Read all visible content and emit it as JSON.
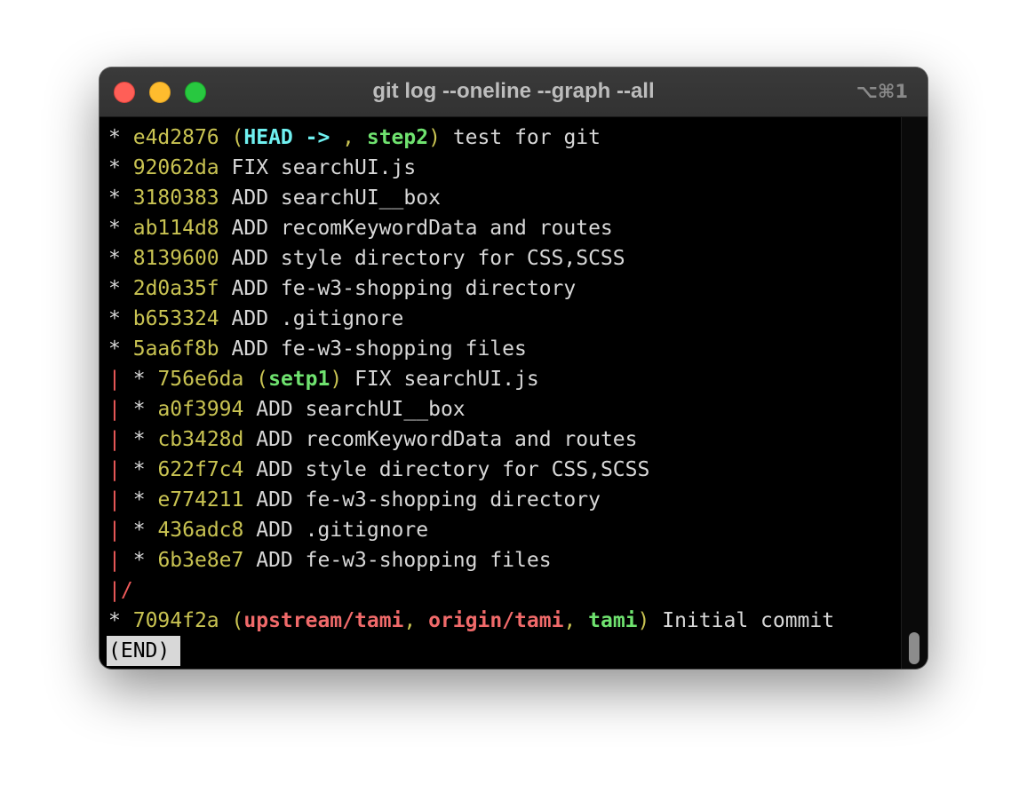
{
  "window": {
    "title": "git log --oneline --graph --all",
    "shortcut": "⌥⌘1"
  },
  "icons": {
    "close": "close-button",
    "minimize": "minimize-button",
    "zoom": "zoom-button"
  },
  "colors": {
    "background": "#000000",
    "text": "#d8d8d8",
    "hash": "#c9c352",
    "graph_branch": "#ee5a5a",
    "head_ref": "#6ff0f0",
    "local_branch": "#6fe26f",
    "remote_branch": "#f06a6a"
  },
  "log": [
    {
      "graph": "* ",
      "hash": "e4d2876",
      "refs": [
        {
          "text": "HEAD -> ",
          "color": "cyan"
        },
        {
          "text": "step2",
          "color": "green"
        }
      ],
      "message": "test for git"
    },
    {
      "graph": "* ",
      "hash": "92062da",
      "refs": [],
      "message": "FIX searchUI.js"
    },
    {
      "graph": "* ",
      "hash": "3180383",
      "refs": [],
      "message": "ADD searchUI__box"
    },
    {
      "graph": "* ",
      "hash": "ab114d8",
      "refs": [],
      "message": "ADD recomKeywordData and routes"
    },
    {
      "graph": "* ",
      "hash": "8139600",
      "refs": [],
      "message": "ADD style directory for CSS,SCSS"
    },
    {
      "graph": "* ",
      "hash": "2d0a35f",
      "refs": [],
      "message": "ADD fe-w3-shopping directory"
    },
    {
      "graph": "* ",
      "hash": "b653324",
      "refs": [],
      "message": "ADD .gitignore"
    },
    {
      "graph": "* ",
      "hash": "5aa6f8b",
      "refs": [],
      "message": "ADD fe-w3-shopping files"
    },
    {
      "graph": "| * ",
      "hash": "756e6da",
      "refs": [
        {
          "text": "setp1",
          "color": "green"
        }
      ],
      "message": "FIX searchUI.js"
    },
    {
      "graph": "| * ",
      "hash": "a0f3994",
      "refs": [],
      "message": "ADD searchUI__box"
    },
    {
      "graph": "| * ",
      "hash": "cb3428d",
      "refs": [],
      "message": "ADD recomKeywordData and routes"
    },
    {
      "graph": "| * ",
      "hash": "622f7c4",
      "refs": [],
      "message": "ADD style directory for CSS,SCSS"
    },
    {
      "graph": "| * ",
      "hash": "e774211",
      "refs": [],
      "message": "ADD fe-w3-shopping directory"
    },
    {
      "graph": "| * ",
      "hash": "436adc8",
      "refs": [],
      "message": "ADD .gitignore"
    },
    {
      "graph": "| * ",
      "hash": "6b3e8e7",
      "refs": [],
      "message": "ADD fe-w3-shopping files"
    },
    {
      "graph": "|/",
      "hash": "",
      "refs": [],
      "message": ""
    },
    {
      "graph": "* ",
      "hash": "7094f2a",
      "refs": [
        {
          "text": "upstream/tami",
          "color": "red"
        },
        {
          "text": "origin/tami",
          "color": "red"
        },
        {
          "text": "tami",
          "color": "green"
        }
      ],
      "message": "Initial commit"
    }
  ],
  "pager": {
    "end_marker": "(END)"
  }
}
